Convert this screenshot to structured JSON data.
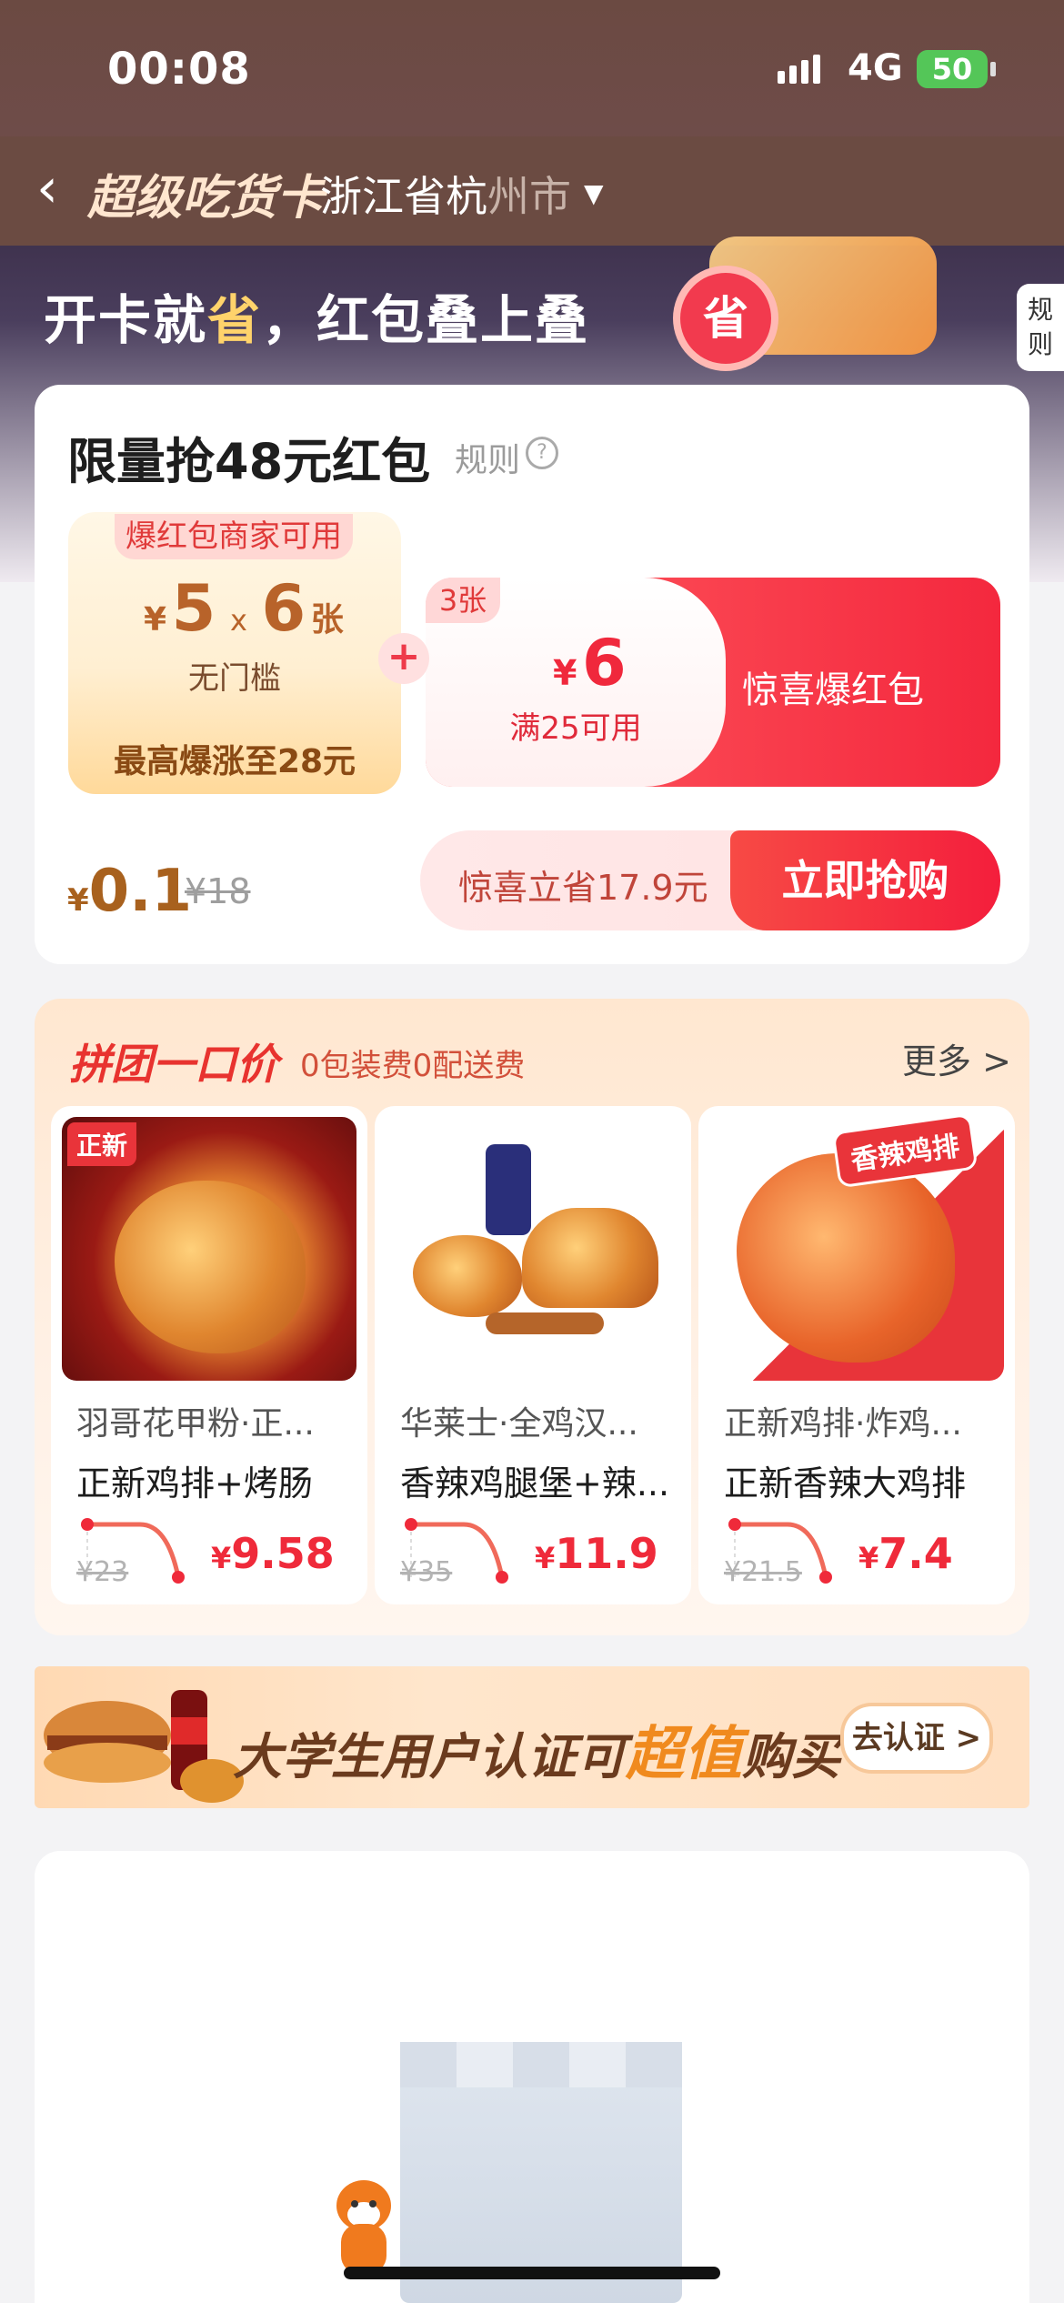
{
  "status_bar": {
    "time": "00:08",
    "network": "4G",
    "battery": "50"
  },
  "nav": {
    "title": "超级吃货卡",
    "location_main": "浙江省杭",
    "location_dim": "州市"
  },
  "hero": {
    "slogan_a": "开卡就",
    "slogan_hl": "省",
    "slogan_b": "，红包叠上叠",
    "badge": "省",
    "rules_side": "规则"
  },
  "promo_card": {
    "title": "限量抢48元红包",
    "rules_link": "规则",
    "coupon_left": {
      "tag": "爆红包商家可用",
      "currency": "¥",
      "amount": "5",
      "multiplier": "x",
      "count": "6",
      "unit": "张",
      "condition": "无门槛",
      "max": "最高爆涨至28元"
    },
    "plus": "+",
    "coupon_right": {
      "count": "3张",
      "currency": "¥",
      "amount": "6",
      "condition": "满25可用",
      "label": "惊喜爆红包"
    },
    "price_currency": "¥",
    "price": "0.1",
    "original_price": "¥18",
    "save_text": "惊喜立省17.9元",
    "buy_button": "立即抢购"
  },
  "group_buy": {
    "title": "拼团一口价",
    "subtitle": "0包装费0配送费",
    "more": "更多 >",
    "products": [
      {
        "tag": "正新",
        "shop": "羽哥花甲粉·正...",
        "name": "正新鸡排+烤肠",
        "orig": "¥23",
        "currency": "¥",
        "price": "9.58"
      },
      {
        "tag": "",
        "shop": "华莱士·全鸡汉...",
        "name": "香辣鸡腿堡+辣...",
        "orig": "¥35",
        "currency": "¥",
        "price": "11.9"
      },
      {
        "tag": "香辣鸡排",
        "shop": "正新鸡排·炸鸡...",
        "name": "正新香辣大鸡排",
        "orig": "¥21.5",
        "currency": "¥",
        "price": "7.4"
      }
    ]
  },
  "student_banner": {
    "text_a": "大学生用户认证可",
    "text_hl": "超值",
    "text_b": "购买",
    "button": "去认证 >"
  },
  "colors": {
    "accent": "#f4283e",
    "brand_brown": "#6b4b42",
    "price_red": "#ef2a3a"
  }
}
